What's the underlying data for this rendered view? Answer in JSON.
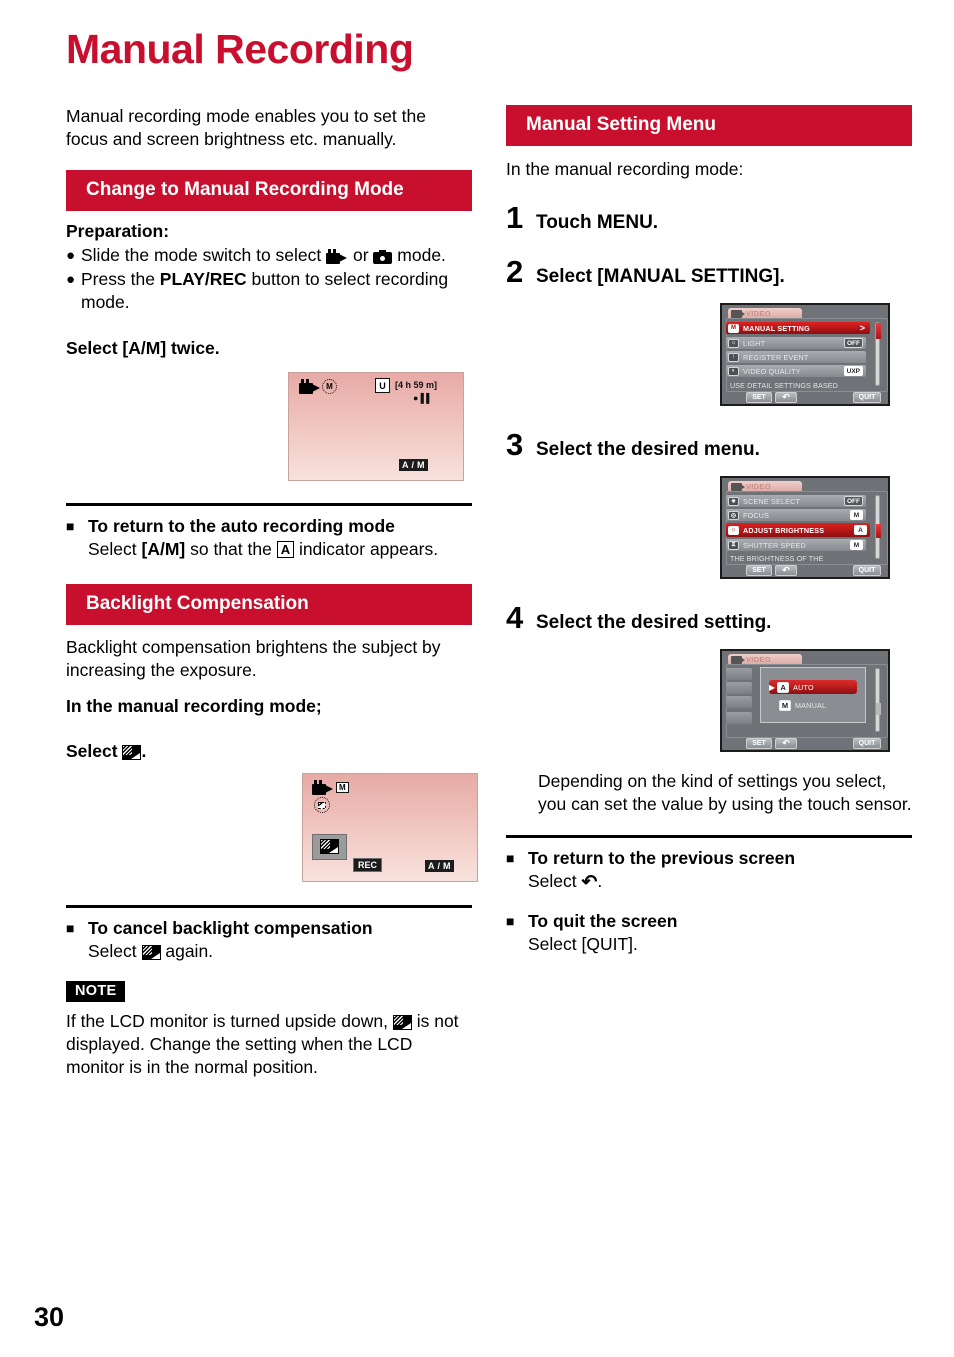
{
  "page": {
    "title": "Manual Recording",
    "number": "30"
  },
  "left": {
    "intro": "Manual recording mode enables you to set the focus and screen brightness etc. manually.",
    "section1_title": "Change to Manual Recording Mode",
    "preparation_label": "Preparation:",
    "bullet1_a": "Slide the mode switch to select ",
    "bullet1_b": " or ",
    "bullet1_c": " mode.",
    "bullet2_a": "Press the ",
    "bullet2_bold": "PLAY/REC",
    "bullet2_b": " button to select recording mode.",
    "select_am_twice": "Select [A/M] twice.",
    "lcd1": {
      "mode_badge": "M",
      "quality_badge": "U",
      "time_remaining": "[4 h 59 m]",
      "rec_standby": "●▐▐",
      "am_a": "A",
      "am_slash": "/",
      "am_m": "M"
    },
    "return_auto_head": "To return to the auto recording mode",
    "return_auto_1": "Select ",
    "return_auto_bold": "[A/M]",
    "return_auto_2": " so that the ",
    "return_auto_indicator": "A",
    "return_auto_3": " indicator appears.",
    "section2_title": "Backlight Compensation",
    "backlight_desc": "Backlight compensation brightens the subject by increasing the exposure.",
    "in_manual_mode": "In the manual recording mode;",
    "select_icon_label": "Select ",
    "select_icon_period": ".",
    "lcd2": {
      "mode_badge": "M",
      "rec_badge": "REC",
      "am_a": "A",
      "am_slash": "/",
      "am_m": "M"
    },
    "cancel_head": "To cancel backlight compensation",
    "cancel_1": "Select ",
    "cancel_2": " again.",
    "note_badge": "NOTE",
    "note_1": "If the LCD monitor is turned upside down, ",
    "note_2": " is not displayed. Change the setting when the LCD monitor is in the normal position."
  },
  "right": {
    "section_title": "Manual Setting Menu",
    "intro": "In the manual recording mode:",
    "steps": [
      {
        "num": "1",
        "label": "Touch  MENU."
      },
      {
        "num": "2",
        "label": "Select [MANUAL SETTING]."
      },
      {
        "num": "3",
        "label": "Select the desired menu."
      },
      {
        "num": "4",
        "label": "Select the desired setting."
      }
    ],
    "menu1": {
      "tab": "VIDEO",
      "rows": [
        {
          "icon": "M",
          "text": "MANUAL SETTING",
          "value": "",
          "chevron": ">",
          "selected": true
        },
        {
          "icon": "☂",
          "text": "LIGHT",
          "value": "OFF",
          "chevron": "",
          "selected": false
        },
        {
          "icon": "↑",
          "text": "REGISTER EVENT",
          "value": "",
          "chevron": "",
          "selected": false
        },
        {
          "icon": "◐",
          "text": "VIDEO QUALITY",
          "value": "UXP",
          "chevron": "",
          "selected": false
        }
      ],
      "hint": "USE DETAIL SETTINGS BASED",
      "btn_set": "SET",
      "btn_back": "↶",
      "btn_quit": "QUIT"
    },
    "menu2": {
      "tab": "VIDEO",
      "rows": [
        {
          "icon": "✹",
          "text": "SCENE SELECT",
          "value": "OFF",
          "chevron": "",
          "selected": false
        },
        {
          "icon": "◎",
          "text": "FOCUS",
          "value": "M",
          "chevron": "",
          "selected": false
        },
        {
          "icon": "☀",
          "text": "ADJUST BRIGHTNESS",
          "value": "A",
          "chevron": "",
          "selected": true
        },
        {
          "icon": "⧖",
          "text": "SHUTTER SPEED",
          "value": "M",
          "chevron": "",
          "selected": false
        }
      ],
      "hint": "THE BRIGHTNESS OF THE",
      "btn_set": "SET",
      "btn_back": "↶",
      "btn_quit": "QUIT"
    },
    "menu3": {
      "tab": "VIDEO",
      "options": [
        {
          "badge": "A",
          "text": "AUTO",
          "selected": true
        },
        {
          "badge": "M",
          "text": "MANUAL",
          "selected": false
        }
      ],
      "btn_set": "SET",
      "btn_back": "↶",
      "btn_quit": "QUIT"
    },
    "depending_note": "Depending on the kind of settings you select, you can set the value by using the touch sensor.",
    "prev_screen_head": "To return to the previous screen",
    "prev_screen_1": "Select ",
    "prev_screen_arrow": "↶",
    "prev_screen_2": ".",
    "quit_head": "To quit the screen",
    "quit_body": "Select [QUIT]."
  },
  "colors": {
    "brand_red": "#c8102e",
    "menu_red": "#e02020"
  }
}
